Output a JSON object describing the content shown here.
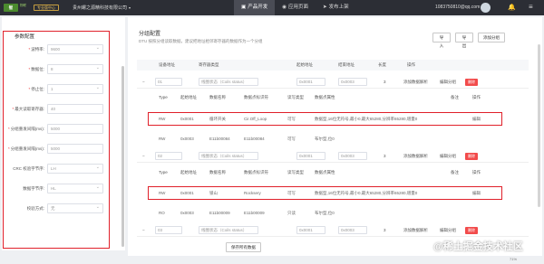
{
  "topbar": {
    "logo": "智",
    "logo_sub": "物联",
    "badge": "专业版中心",
    "company": "贵州螺之源精科技有限公司",
    "nav": [
      {
        "label": "产品开发",
        "icon": "▣"
      },
      {
        "label": "应用页面",
        "icon": "◉"
      },
      {
        "label": "发布上架",
        "icon": "➤"
      }
    ],
    "user": "1083750810@qq.com"
  },
  "left": {
    "title": "参数配置",
    "fields": [
      {
        "label": "波特率:",
        "value": "9600",
        "required": "*",
        "select": true
      },
      {
        "label": "数据位:",
        "value": "8",
        "required": "*",
        "select": true
      },
      {
        "label": "停止位:",
        "value": "1",
        "required": "*",
        "select": true
      },
      {
        "label": "最大读取寄存器:",
        "value": "40",
        "required": "*",
        "select": false
      },
      {
        "label": "分组重发间隔(ms):",
        "value": "5000",
        "required": "*",
        "select": false
      },
      {
        "label": "分组重发间隔(ms):",
        "value": "5000",
        "required": "*",
        "select": false
      },
      {
        "label": "CRC 校验字节序:",
        "value": "LH",
        "required": "",
        "select": true
      },
      {
        "label": "数据字节序:",
        "value": "HL",
        "required": "",
        "select": true
      },
      {
        "label": "校验方式:",
        "value": "无",
        "required": "",
        "select": true
      }
    ]
  },
  "main": {
    "title": "分组配置",
    "desc": "DTU 按照分组读取数据，建议把地址相邻寄存器的数据作为一个分组",
    "buttons": {
      "import": "导入",
      "export": "导出",
      "add": "添加分组"
    },
    "headers": [
      "设备地址",
      "寄存器类型",
      "起始地址",
      "结束地址",
      "长度",
      "操作"
    ],
    "sub_headers": [
      "Type",
      "起始地址",
      "数据名称",
      "数据点标识符",
      "读写类型",
      "数据点属性",
      "备注",
      "操作"
    ],
    "groups": [
      {
        "addr": "01",
        "type": "线圈状态（Coils status）",
        "start": "0x0001",
        "end": "0x0003",
        "len": "3",
        "add_dp": "添加数据解析",
        "edit_group": "编辑分组",
        "delete": "删除",
        "items": [
          {
            "t": "RW",
            "start": "0x0001",
            "name": "循环开关",
            "id": "Cir.Off_Loop",
            "rw": "可写",
            "attr": "数据型,16位无符号,最小0,最大65280,分辨率65280,增量0",
            "note": "",
            "op": "编辑"
          },
          {
            "t": "RW",
            "start": "0x0003",
            "name": "E11b00084",
            "id": "E11b00084",
            "rw": "可写",
            "attr": "布尔型,位0",
            "note": "",
            "op": ""
          }
        ]
      },
      {
        "addr": "02",
        "type": "线圈状态（Coils status）",
        "start": "0x0001",
        "end": "0x0003",
        "len": "3",
        "add_dp": "添加数据解析",
        "edit_group": "编辑分组",
        "delete": "删除",
        "items": [
          {
            "t": "RW",
            "start": "0x0001",
            "name": "锁山",
            "id": "Rocksery",
            "rw": "可写",
            "attr": "数据型,16位无符号,最小0,最大65280,分辨率65280,增量0",
            "note": "",
            "op": "编辑"
          },
          {
            "t": "RO",
            "start": "0x0003",
            "name": "E11b00009",
            "id": "E11b00009",
            "rw": "只读",
            "attr": "布尔型,位0",
            "note": "",
            "op": ""
          }
        ]
      },
      {
        "addr": "03",
        "type": "线圈状态（Coils status）",
        "start": "0x0001",
        "end": "0x0003",
        "len": "3",
        "add_dp": "添加数据解析",
        "edit_group": "编辑分组",
        "delete": "删除"
      }
    ],
    "save": "保存所有数据"
  },
  "status": {
    "zoom": "71%"
  },
  "watermark": "@稀土掘金技术社区",
  "colors": {
    "topbar": "#2c2e35",
    "highlight": "#e0202a",
    "danger": "#f24b4b",
    "accent_green": "#4b8a2e"
  }
}
